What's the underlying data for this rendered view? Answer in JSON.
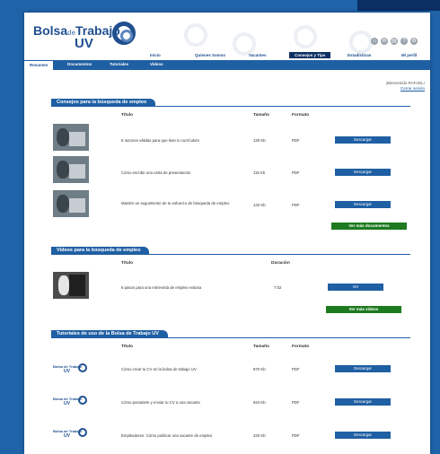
{
  "brand": {
    "name_part1": "Bolsa",
    "name_part2": "de",
    "name_part3": "Trabajo",
    "name_part4": "UV"
  },
  "top_nav": [
    {
      "label": "Inicio"
    },
    {
      "label": "Quienes Somos"
    },
    {
      "label": "Vacantes"
    },
    {
      "label": "Consejos y Tips"
    },
    {
      "label": "Estadísticas"
    },
    {
      "label": "Mi perfil"
    }
  ],
  "sub_nav": [
    {
      "label": "Resumen"
    },
    {
      "label": "Documentos"
    },
    {
      "label": "Tutoriales"
    },
    {
      "label": "Videos"
    }
  ],
  "welcome": {
    "text": "¡Bienvenido RAFAEL!",
    "logout": "Cerrar sesión"
  },
  "documents": {
    "title": "Consejos para la búsqueda de empleo",
    "headers": {
      "title": "Título",
      "size": "Tamaño",
      "format": "Formato"
    },
    "rows": [
      {
        "title": "5 razones válidas para que lean tu currículum",
        "size": "130 Kb",
        "format": "PDF",
        "action": "Descargar"
      },
      {
        "title": "Cómo escribir una carta de presentación",
        "size": "115 Kb",
        "format": "PDF",
        "action": "Descargar"
      },
      {
        "title": "Mantén un seguimiento de tu esfuerzo de búsqueda de empleo",
        "size": "132 Kb",
        "format": "PDF",
        "action": "Descargar"
      }
    ],
    "more": "Ver más documentos"
  },
  "videos": {
    "title": "Videos para la búsqueda de empleo",
    "headers": {
      "title": "Título",
      "duration": "Duración"
    },
    "rows": [
      {
        "title": "6 pasos para una entrevista de empleo exitosa",
        "duration": "7:02",
        "action": "Ver"
      }
    ],
    "more": "Ver más videos"
  },
  "tutorials": {
    "title": "Tutoriales de uso de la Bolsa de Trabajo UV",
    "headers": {
      "title": "Título",
      "size": "Tamaño",
      "format": "Formato"
    },
    "rows": [
      {
        "title": "Cómo crear tu CV en la bolsa de trabajo UV",
        "size": "870 Kb",
        "format": "PDF",
        "action": "Descargar"
      },
      {
        "title": "Cómo postularte y enviar tu CV a una vacante",
        "size": "944 Kb",
        "format": "PDF",
        "action": "Descargar"
      },
      {
        "title": "Empleadores: Cómo publicar una vacante de empleo",
        "size": "420 Kb",
        "format": "PDF",
        "action": "Descargar"
      }
    ]
  },
  "icons": [
    "home-icon",
    "mail-icon",
    "print-icon",
    "help-icon",
    "settings-icon"
  ],
  "colors": {
    "primary": "#1f5fa3",
    "dark": "#0b2f63",
    "green": "#1d7a1f"
  }
}
